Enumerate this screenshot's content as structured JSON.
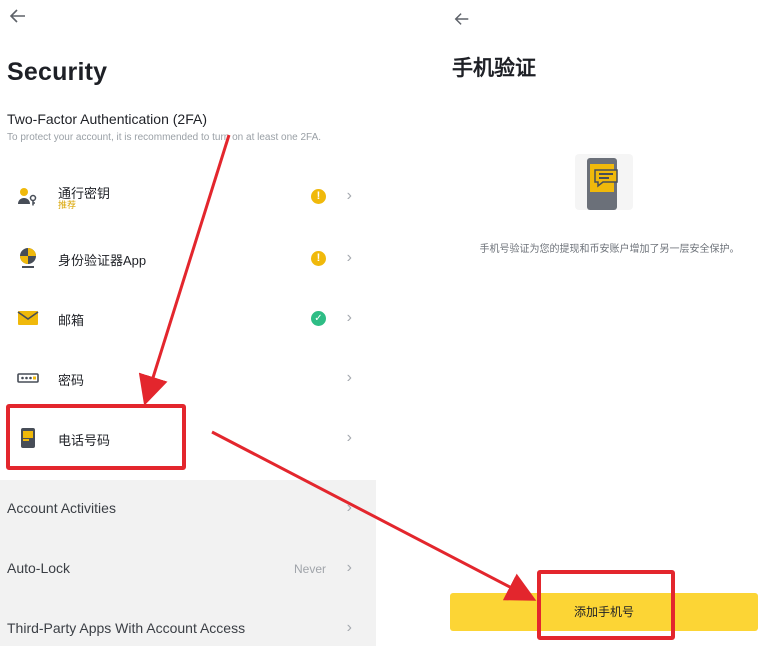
{
  "left": {
    "title": "Security",
    "section_title": "Two-Factor Authentication (2FA)",
    "section_sub": "To protect your account, it is recommended to turn on at least one 2FA.",
    "items": [
      {
        "label": "通行密钥",
        "sub": "推荐",
        "status": "warning",
        "icon": "passkey-icon"
      },
      {
        "label": "身份验证器App",
        "status": "warning",
        "icon": "authenticator-icon"
      },
      {
        "label": "邮箱",
        "status": "enabled",
        "icon": "mail-icon"
      },
      {
        "label": "密码",
        "status": "none",
        "icon": "password-icon"
      },
      {
        "label": "电话号码",
        "status": "none",
        "icon": "phone-icon"
      }
    ],
    "more_items": [
      {
        "label": "Account Activities",
        "value": ""
      },
      {
        "label": "Auto-Lock",
        "value": "Never"
      },
      {
        "label": "Third-Party Apps With Account Access",
        "value": ""
      }
    ]
  },
  "right": {
    "title": "手机验证",
    "description": "手机号验证为您的提现和币安账户增加了另一层安全保护。",
    "button_label": "添加手机号"
  },
  "colors": {
    "accent": "#fcd535",
    "warning": "#f0b90b",
    "success": "#2ebd85",
    "annotation": "#e3262d"
  }
}
